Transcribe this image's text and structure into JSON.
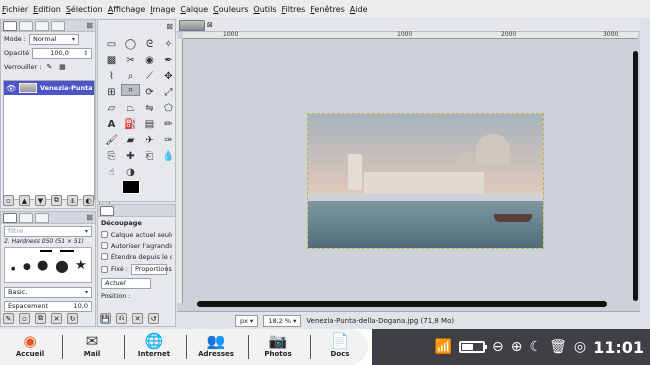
{
  "menubar": {
    "items": [
      "Fichier",
      "Edition",
      "Sélection",
      "Affichage",
      "Image",
      "Calque",
      "Couleurs",
      "Outils",
      "Filtres",
      "Fenêtres",
      "Aide"
    ]
  },
  "layers": {
    "mode_label": "Mode :",
    "mode_value": "Normal",
    "opacity_label": "Opacité",
    "opacity_value": "100,0",
    "lock_label": "Verrouiller :",
    "layer_name": "Venezia-Punta"
  },
  "brushes": {
    "filter_placeholder": "filtre",
    "brush_name": "2. Hardness 050 (51 × 51)",
    "preset": "Basic,",
    "spacing_label": "Espacement",
    "spacing_value": "10,0"
  },
  "tooloptions": {
    "title": "Découpage",
    "opt1": "Calque actuel seule",
    "opt2": "Autoriser l'agrandis",
    "opt3": "Étendre depuis le c",
    "fixed_label": "Fixé :",
    "fixed_value": "Proportions",
    "actuel": "Actuel",
    "position_label": "Position :"
  },
  "canvas": {
    "ruler_ticks": [
      "1000",
      "1000",
      "2000",
      "3000"
    ],
    "zoom_unit": "px",
    "zoom_value": "18,2 %",
    "status_text": "Venezia-Punta-della-Dogana.jpg (71,8 Mo)"
  },
  "taskbar": {
    "items": [
      {
        "label": "Accueil",
        "icon": "home-icon"
      },
      {
        "label": "Mail",
        "icon": "mail-icon"
      },
      {
        "label": "Internet",
        "icon": "globe-icon"
      },
      {
        "label": "Adresses",
        "icon": "contacts-icon"
      },
      {
        "label": "Photos",
        "icon": "camera-icon"
      },
      {
        "label": "Docs",
        "icon": "docs-icon"
      }
    ],
    "clock": "11:01",
    "battery_level": 0.55
  }
}
